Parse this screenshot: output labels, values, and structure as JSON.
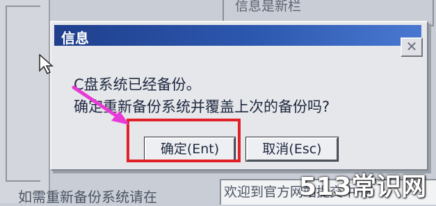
{
  "background": {
    "group_title": "信息是新栏",
    "bottom_left_text": "如需重新备份系统请在",
    "bottom_right_text": "欢迎到官方网站提交中 解"
  },
  "dialog": {
    "title": "信息",
    "close_glyph": "✕",
    "message_line1": "C盘系统已经备份。",
    "message_line2": "确定重新备份系统并覆盖上次的备份吗?",
    "ok_label": "确定(Ent)",
    "cancel_label": "取消(Esc)"
  },
  "watermark": "513常识网",
  "colors": {
    "highlight": "#e0212a",
    "arrow": "#e83ad6",
    "titlebar": "#1f3f8c"
  }
}
